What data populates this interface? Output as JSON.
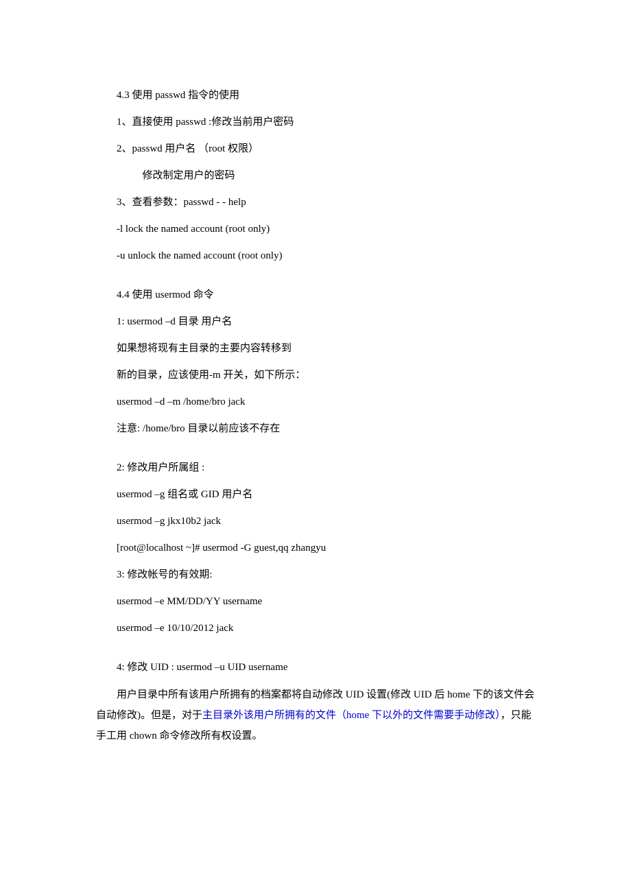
{
  "lines": {
    "l01": "4.3 使用 passwd 指令的使用",
    "l02": "1、直接使用 passwd :修改当前用户密码",
    "l03": "2、passwd 用户名  （root 权限）",
    "l04": "修改制定用户的密码",
    "l05": "3、查看参数：passwd - - help",
    "l06": "-l lock the named account (root only)",
    "l07": "-u unlock the named account (root only)",
    "l08": "4.4 使用 usermod 命令",
    "l09": "1: usermod –d 目录 用户名",
    "l10": "如果想将现有主目录的主要内容转移到",
    "l11": "新的目录，应该使用-m 开关，如下所示：",
    "l12": "usermod –d –m /home/bro  jack",
    "l13": "注意: /home/bro 目录以前应该不存在",
    "l14": "2: 修改用户所属组 :",
    "l15": " usermod –g  组名或 GID 用户名",
    "l16": " usermod –g  jkx10b2 jack",
    "l17": "[root@localhost ~]# usermod -G guest,qq  zhangyu",
    "l18": "3: 修改帐号的有效期:",
    "l19": "usermod –e MM/DD/YY username",
    "l20": "usermod –e  10/10/2012 jack",
    "l21": "4: 修改 UID : usermod –u UID username",
    "p1a": "用户目录中所有该用户所拥有的档案都将自动修改 UID 设置(修改 UID 后 home 下的该文件会自动修改)。但是，对于",
    "p1b": "主目录外该用户所拥有的文件（home 下以外的文件需要手动修改）",
    "p1c": "，只能手工用 chown 命令修改所有权设置。"
  }
}
